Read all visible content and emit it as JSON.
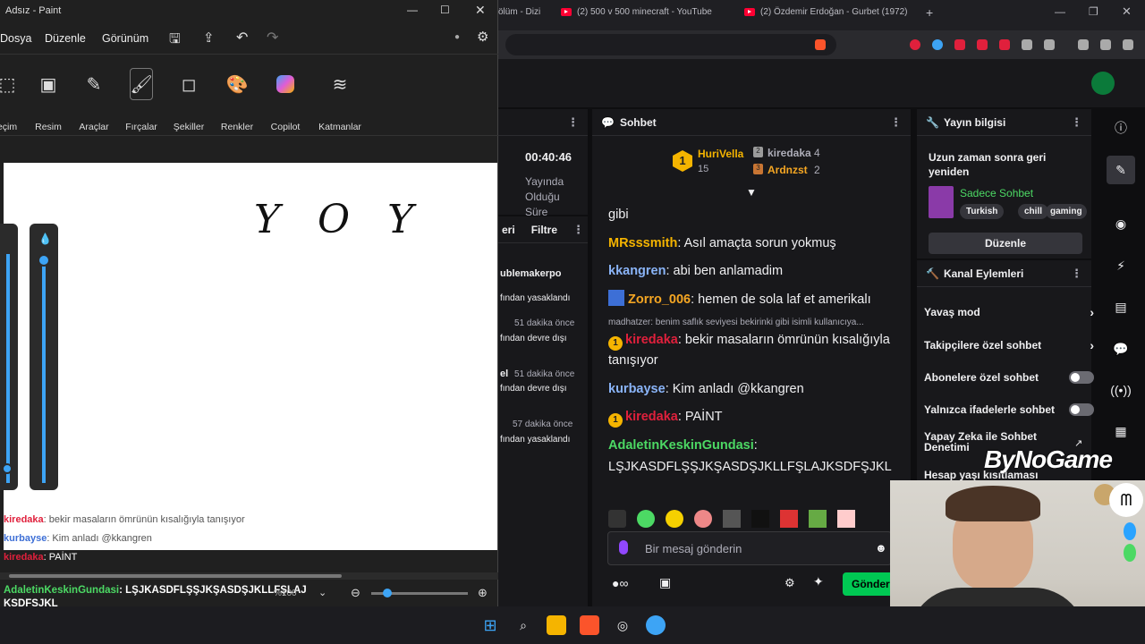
{
  "browser": {
    "tabs": [
      {
        "label": "ölüm - Dizi",
        "left": 0
      },
      {
        "label": "(2) 500 v 500 minecraft - YouTube",
        "left": 0
      },
      {
        "label": "(2) Özdemir Erdoğan - Gurbet (1972)",
        "left": 0
      }
    ],
    "new_tab": "+"
  },
  "paint": {
    "title": "Adsız - Paint",
    "menu": [
      "Dosya",
      "Düzenle",
      "Görünüm"
    ],
    "tools": [
      "eçim",
      "Resim",
      "Araçlar",
      "Fırçalar",
      "Şekiller",
      "Renkler",
      "Copilot",
      "Katmanlar"
    ],
    "canvas_text": "Y O Y",
    "zoom_label": "%100"
  },
  "stream_info": {
    "uptime": "00:40:46",
    "uptime_label_1": "Yayında",
    "uptime_label_2": "Olduğu",
    "uptime_label_3": "Süre"
  },
  "mod_log": {
    "tab_label": "eri",
    "filter_label": "Filtre",
    "entries": [
      {
        "name": "ublemakerpo",
        "action": "fından yasaklandı",
        "time": ""
      },
      {
        "name": "",
        "action": "fından devre dışı",
        "time": "51 dakika önce"
      },
      {
        "name": "el",
        "action": "fından devre dışı",
        "time": "51 dakika önce"
      },
      {
        "name": "",
        "action": "fından yasaklandı",
        "time": "57 dakika önce"
      }
    ]
  },
  "chat": {
    "title": "Sohbet",
    "leaders": [
      {
        "name": "HuriVella",
        "count": "15",
        "rank": "1"
      },
      {
        "name": "kiredaka",
        "count": "4",
        "rank": "2"
      },
      {
        "name": "Ardnzst",
        "count": "2",
        "rank": "3"
      }
    ],
    "messages": [
      {
        "user": "",
        "text": "gibi",
        "color": "#efeff1"
      },
      {
        "user": "MRsssmith",
        "text": ": Asıl amaçta sorun yokmuş",
        "color": "#f5b400"
      },
      {
        "user": "kkangren",
        "text": ": abi ben anlamadim",
        "color": "#8ab4f8"
      },
      {
        "user": "Zorro_006",
        "text": ": hemen de sola laf et amerikalı",
        "color": "#f5a623"
      },
      {
        "user": "kiredaka",
        "text": ": bekir masaların ömrünün kısalığıyla tanışıyor",
        "color": "#e0203c"
      },
      {
        "user": "kurbayse",
        "text": ": Kim anladı @kkangren",
        "color": "#8ab4f8"
      },
      {
        "user": "kiredaka",
        "text": ": PAİNT",
        "color": "#e0203c"
      },
      {
        "user": "AdaletinKeskinGundasi",
        "text": ":",
        "color": "#4cd964"
      },
      {
        "user": "",
        "text": "LŞJKASDFLŞŞJKŞASDŞJKLLFŞLAJKSDFŞJKL",
        "color": "#efeff1"
      }
    ],
    "reply_preview": "madhatzer: benim saflık seviyesi bekirinki gibi isimli kullanıcıya...",
    "input_placeholder": "Bir mesaj gönderin",
    "send_label": "Gönder"
  },
  "stream_panel": {
    "title": "Yayın bilgisi",
    "stream_title": "Uzun zaman sonra geri yeniden",
    "category": "Sadece Sohbet",
    "tags": [
      "Turkish",
      "chill",
      "gaming"
    ],
    "edit_label": "Düzenle"
  },
  "channel_actions": {
    "title": "Kanal Eylemleri",
    "items": [
      {
        "label": "Yavaş mod",
        "kind": "chevron"
      },
      {
        "label": "Takipçilere özel sohbet",
        "kind": "chevron"
      },
      {
        "label": "Abonelere özel sohbet",
        "kind": "toggle"
      },
      {
        "label": "Yalnızca ifadelerle sohbet",
        "kind": "toggle"
      },
      {
        "label": "Yapay Zeka ile Sohbet Denetimi",
        "kind": "link"
      },
      {
        "label": "Hesap yaşı kısıtlaması",
        "kind": "chevron"
      }
    ]
  },
  "overlay": {
    "brand": "ByNoGame",
    "chat": [
      {
        "user": "kiredaka",
        "text": ": bekir masaların ömrünün kısalığıyla tanışıyor"
      },
      {
        "user": "kurbayse",
        "text": ": Kim anladı @kkangren"
      },
      {
        "user": "kiredaka",
        "text": ": PAİNT"
      },
      {
        "user": "AdaletinKeskinGundasi",
        "text": ": LŞJKASDFLŞŞJKŞASDŞJKLLFŞLAJ"
      },
      {
        "user": "",
        "text": "KSDFŞJKL"
      }
    ]
  },
  "colors": {
    "twitch_purple": "#9147ff",
    "send_green": "#00c853",
    "gold": "#f5b400"
  }
}
